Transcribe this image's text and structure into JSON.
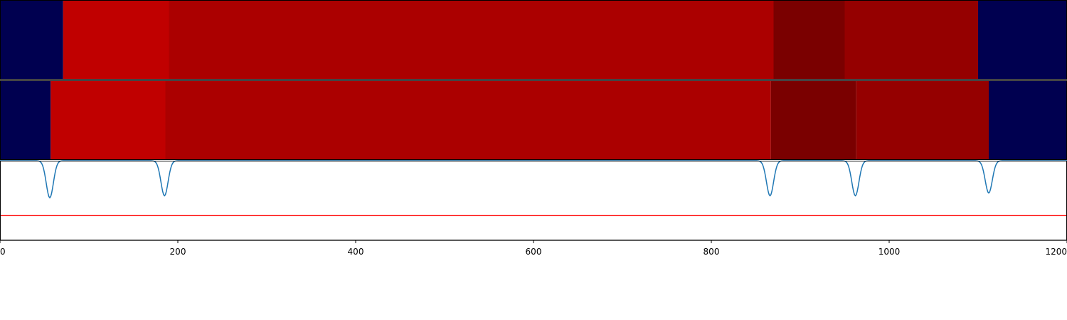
{
  "chart_data": {
    "type": "heatmap",
    "title": "",
    "xlabel": "",
    "ylabel": "",
    "xlim": [
      0,
      1200
    ],
    "x_ticks": [
      "0",
      "200",
      "400",
      "600",
      "800",
      "1000",
      "1200"
    ],
    "x_tick_values": [
      0,
      200,
      400,
      600,
      800,
      1000,
      1200
    ],
    "grid": false,
    "colors": {
      "navy": "#000050",
      "red_bright": "#c00000",
      "red": "#ab0000",
      "red_darkest": "#7a0000",
      "red_dark": "#950000",
      "signal_line": "#1f77b4",
      "threshold_line": "#ff0000"
    },
    "segment_rows": [
      {
        "segments": [
          {
            "start": 0,
            "end": 71,
            "color": "#000050"
          },
          {
            "start": 71,
            "end": 190,
            "color": "#c00000"
          },
          {
            "start": 190,
            "end": 870,
            "color": "#ab0000"
          },
          {
            "start": 870,
            "end": 950,
            "color": "#7a0000"
          },
          {
            "start": 950,
            "end": 1100,
            "color": "#950000"
          },
          {
            "start": 1100,
            "end": 1200,
            "color": "#000050"
          }
        ]
      },
      {
        "segments": [
          {
            "start": 0,
            "end": 57,
            "color": "#000050"
          },
          {
            "start": 57,
            "end": 186,
            "color": "#c00000"
          },
          {
            "start": 186,
            "end": 867,
            "color": "#ab0000"
          },
          {
            "start": 867,
            "end": 963,
            "color": "#7a0000"
          },
          {
            "start": 963,
            "end": 1112,
            "color": "#950000"
          },
          {
            "start": 1112,
            "end": 1200,
            "color": "#000050"
          }
        ]
      }
    ],
    "signal": {
      "baseline": 1.0,
      "ylim": [
        -1.0,
        1.0
      ],
      "dips": [
        {
          "x": 56,
          "depth": 0.93
        },
        {
          "x": 185,
          "depth": 0.88
        },
        {
          "x": 866,
          "depth": 0.88
        },
        {
          "x": 962,
          "depth": 0.88
        },
        {
          "x": 1112,
          "depth": 0.81
        }
      ],
      "threshold": -0.38
    }
  }
}
